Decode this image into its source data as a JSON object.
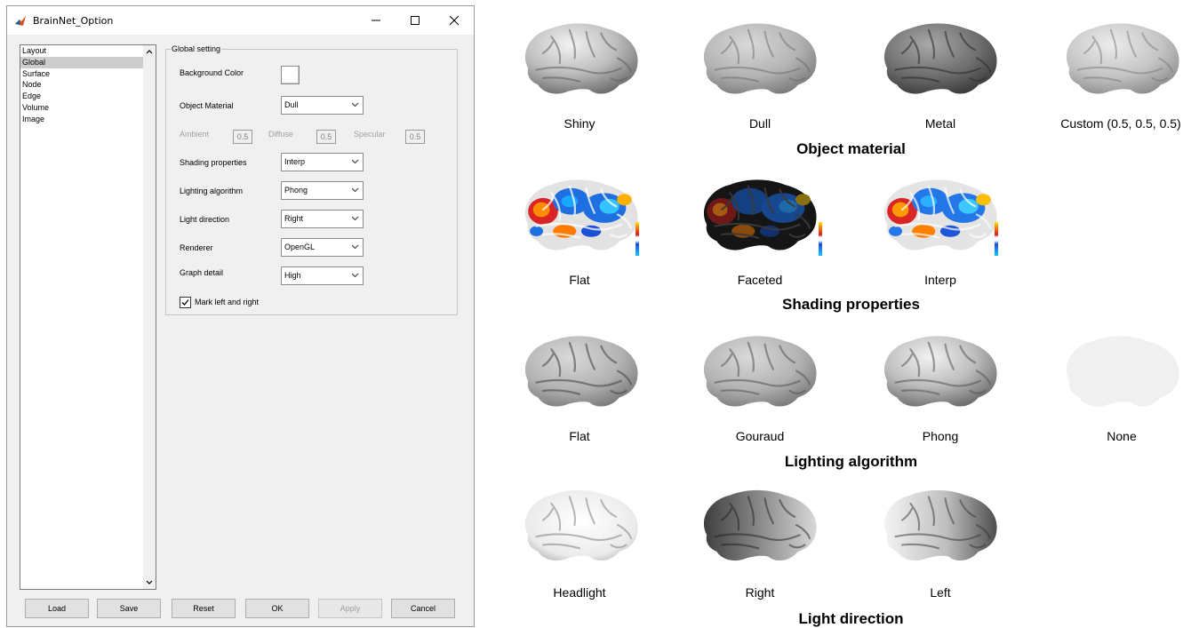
{
  "window": {
    "title": "BrainNet_Option",
    "minimize_glyph": "—",
    "maximize_glyph": "☐",
    "close_glyph": "✕"
  },
  "list": {
    "items": [
      "Layout",
      "Global",
      "Surface",
      "Node",
      "Edge",
      "Volume",
      "Image"
    ],
    "selected": "Global"
  },
  "global": {
    "group_title": "Global setting",
    "background_color_label": "Background Color",
    "object_material_label": "Object Material",
    "object_material_value": "Dull",
    "ambient_label": "Ambient",
    "ambient_value": "0.5",
    "diffuse_label": "Diffuse",
    "diffuse_value": "0.5",
    "specular_label": "Specular",
    "specular_value": "0.5",
    "shading_label": "Shading properties",
    "shading_value": "Interp",
    "lighting_label": "Lighting algorithm",
    "lighting_value": "Phong",
    "light_dir_label": "Light direction",
    "light_dir_value": "Right",
    "renderer_label": "Renderer",
    "renderer_value": "OpenGL",
    "graph_detail_label": "Graph detail",
    "graph_detail_value": "High",
    "mark_lr_label": "Mark left and right",
    "mark_lr_checked": true
  },
  "buttons": {
    "load": "Load",
    "save": "Save",
    "reset": "Reset",
    "ok": "OK",
    "apply": "Apply",
    "cancel": "Cancel"
  },
  "panel": {
    "material": {
      "title": "Object material",
      "captions": [
        "Shiny",
        "Dull",
        "Metal",
        "Custom (0.5, 0.5, 0.5)"
      ]
    },
    "shading": {
      "title": "Shading properties",
      "captions": [
        "Flat",
        "Faceted",
        "Interp"
      ]
    },
    "lighting": {
      "title": "Lighting algorithm",
      "captions": [
        "Flat",
        "Gouraud",
        "Phong",
        "None"
      ]
    },
    "direction": {
      "title": "Light direction",
      "captions": [
        "Headlight",
        "Right",
        "Left"
      ]
    }
  },
  "colors": {
    "selected_item_bg": "#cccccc",
    "window_bg": "#f0f0f0",
    "matlab_icon": "#d9541e"
  },
  "icons": [
    "matlab-app-icon",
    "minimize-icon",
    "maximize-icon",
    "close-icon",
    "scroll-up-icon",
    "scroll-down-icon",
    "chevron-down-icon",
    "checkmark-icon"
  ]
}
